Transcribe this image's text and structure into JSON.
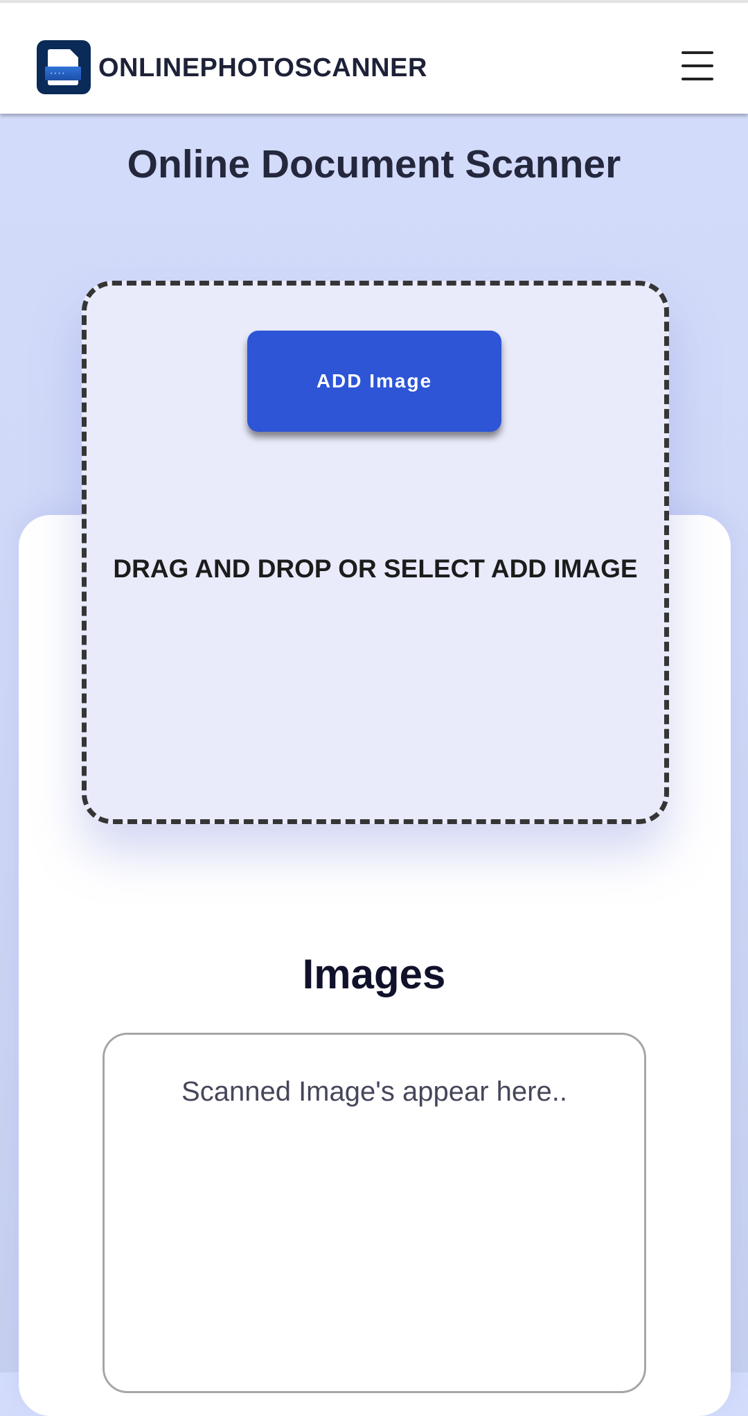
{
  "header": {
    "brand": "ONLINEPHOTOSCANNER",
    "logo_icon": "scanner-document-icon",
    "menu_icon": "hamburger-menu-icon"
  },
  "main": {
    "title": "Online Document Scanner",
    "add_button_label": "ADD Image",
    "drop_text": "DRAG AND DROP OR SELECT ADD IMAGE",
    "images_heading": "Images",
    "images_placeholder": "Scanned Image's appear here.."
  },
  "colors": {
    "accent": "#2d55d6",
    "background": "#d3dcfb",
    "dropzone_fill": "#e9ebfb",
    "logo_bg": "#0a2a57"
  }
}
